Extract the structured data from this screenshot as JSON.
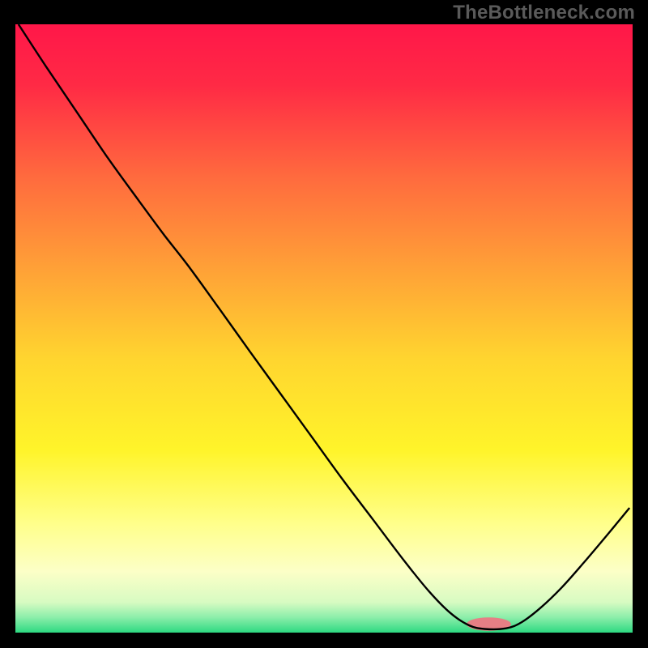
{
  "watermark": "TheBottleneck.com",
  "chart_data": {
    "type": "line",
    "title": "",
    "xlabel": "",
    "ylabel": "",
    "xlim": [
      0,
      100
    ],
    "ylim": [
      0,
      100
    ],
    "grid": false,
    "background_gradient": {
      "stops": [
        {
          "offset": 0.0,
          "color": "#ff1749"
        },
        {
          "offset": 0.1,
          "color": "#ff2a45"
        },
        {
          "offset": 0.25,
          "color": "#ff6a3e"
        },
        {
          "offset": 0.4,
          "color": "#ffa037"
        },
        {
          "offset": 0.55,
          "color": "#ffd52f"
        },
        {
          "offset": 0.7,
          "color": "#fff42a"
        },
        {
          "offset": 0.82,
          "color": "#ffff8a"
        },
        {
          "offset": 0.9,
          "color": "#fcffc7"
        },
        {
          "offset": 0.95,
          "color": "#d7fbc2"
        },
        {
          "offset": 0.975,
          "color": "#8ceeaa"
        },
        {
          "offset": 1.0,
          "color": "#2dd981"
        }
      ]
    },
    "marker": {
      "cx": 76.7,
      "cy": 1.4,
      "rx": 3.6,
      "ry": 1.1,
      "color": "#e67f85"
    },
    "series": [
      {
        "name": "curve",
        "color": "#000000",
        "x": [
          0.5,
          5,
          10,
          15,
          20,
          24,
          28,
          33,
          38,
          43,
          48,
          53,
          58,
          63,
          67,
          70.5,
          73.5,
          76,
          79.5,
          82,
          85,
          88.5,
          92,
          96,
          99.5
        ],
        "values": [
          100,
          93,
          85.5,
          78,
          71,
          65.5,
          60.3,
          53.3,
          46.2,
          39.2,
          32.2,
          25.2,
          18.5,
          11.8,
          6.8,
          3.2,
          1.2,
          0.6,
          0.7,
          1.7,
          4.0,
          7.4,
          11.4,
          16.2,
          20.5
        ]
      }
    ]
  }
}
